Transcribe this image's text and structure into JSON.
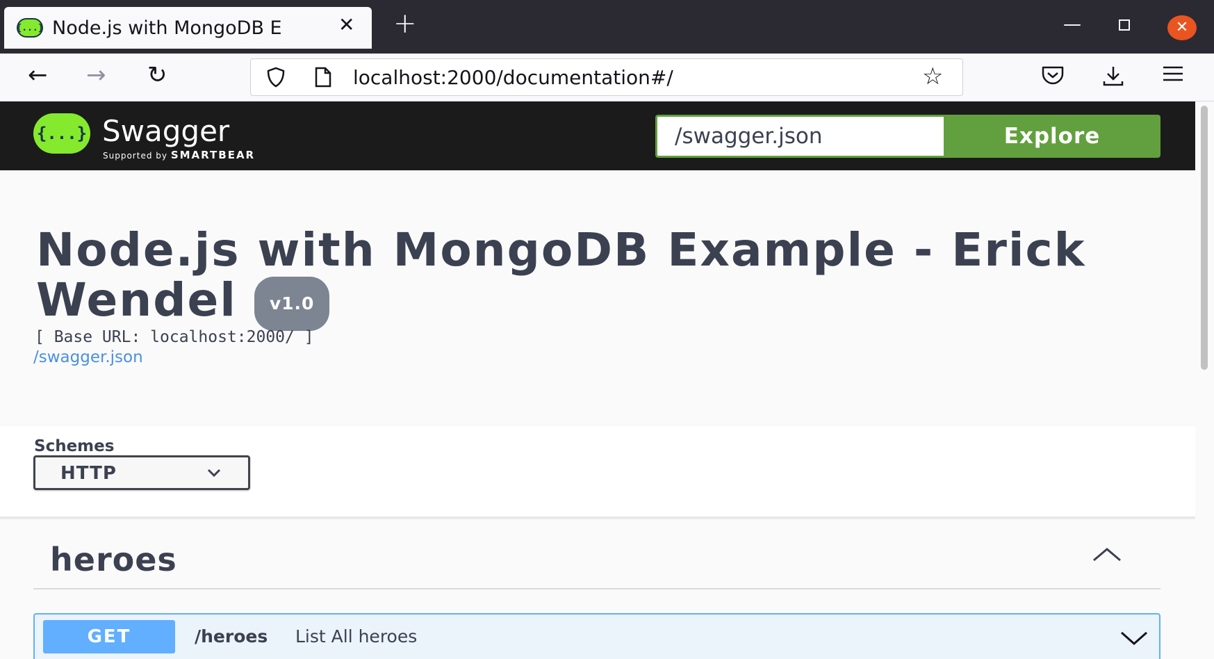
{
  "browser": {
    "tab_title": "Node.js with MongoDB E",
    "new_tab_label": "+",
    "close_tab_label": "✕",
    "url": "localhost:2000/documentation#/",
    "window_close_label": "✕"
  },
  "swagger": {
    "logo_text": "Swagger",
    "logo_mark": "{...}",
    "supported_by": "Supported by",
    "smartbear": "SMARTBEAR",
    "spec_url_value": "/swagger.json",
    "explore_label": "Explore"
  },
  "info": {
    "title": "Node.js with MongoDB Example - Erick Wendel",
    "version": "v1.0",
    "base_url": "[ Base URL: localhost:2000/ ]",
    "spec_link": "/swagger.json"
  },
  "schemes": {
    "label": "Schemes",
    "selected": "HTTP"
  },
  "tags": [
    {
      "name": "heroes",
      "operations": [
        {
          "method": "GET",
          "path": "/heroes",
          "summary": "List All heroes"
        }
      ]
    }
  ],
  "colors": {
    "swagger_green": "#85ea2d",
    "explore_green": "#62a03f",
    "get_blue": "#61affe",
    "topbar_bg": "#1b1b1b",
    "text_dark": "#3b4151",
    "link_blue": "#4990e2"
  },
  "icons": {
    "nav_back": "arrow-left-icon",
    "nav_forward": "arrow-right-icon",
    "reload": "reload-icon",
    "shield": "shield-icon",
    "page": "page-icon",
    "bookmark": "star-icon",
    "pocket": "pocket-icon",
    "download": "download-icon",
    "menu": "hamburger-menu-icon"
  }
}
